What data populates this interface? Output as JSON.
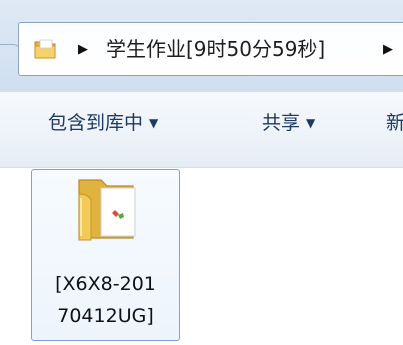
{
  "address_bar": {
    "breadcrumb": "学生作业[9时50分59秒]"
  },
  "toolbar": {
    "items": [
      {
        "label": "包含到库中"
      },
      {
        "label": "共享"
      },
      {
        "label": "新"
      }
    ]
  },
  "file": {
    "name_line1": "[X6X8-201",
    "name_line2": "70412UG]"
  },
  "colors": {
    "toolbar_text": "#1d3a63",
    "selection_border": "#7da2ce",
    "folder_yellow": "#f1c64d"
  }
}
